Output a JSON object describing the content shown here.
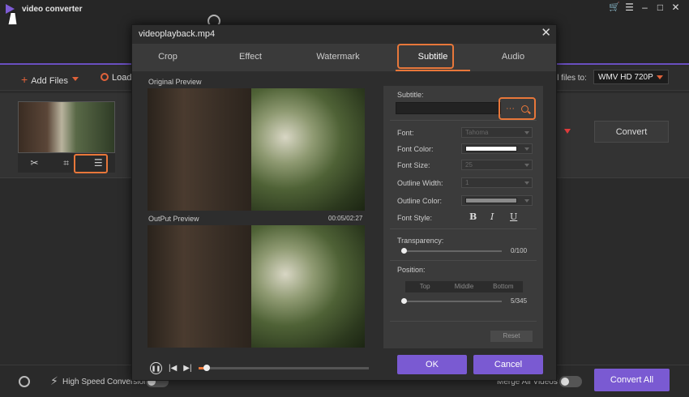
{
  "app": {
    "title": "video converter",
    "toolbar": {
      "add_files": "Add Files",
      "load": "Load"
    },
    "convert_all_label": "ll files to:",
    "format_value": "WMV HD 720P",
    "convert_button": "Convert",
    "footer": {
      "high_speed_label": "High Speed Conversion",
      "merge_label": "Merge All Videos",
      "convert_all_button": "Convert All"
    },
    "accent": "#7a5ad2",
    "highlight": "#e8773a"
  },
  "dialog": {
    "title": "videoplayback.mp4",
    "tabs": [
      "Crop",
      "Effect",
      "Watermark",
      "Subtitle",
      "Audio"
    ],
    "active_tab": "Subtitle",
    "original_preview_label": "Original Preview",
    "output_preview_label": "OutPut Preview",
    "timecode": "00:05/02:27",
    "subtitle": {
      "label": "Subtitle:",
      "more_glyph": "···",
      "font_label": "Font:",
      "font_value": "Tahoma",
      "font_color_label": "Font Color:",
      "font_color": "#ffffff",
      "font_size_label": "Font Size:",
      "font_size_value": "25",
      "outline_width_label": "Outline Width:",
      "outline_width_value": "1",
      "outline_color_label": "Outline Color:",
      "outline_color": "#8a8a8a",
      "font_style_label": "Font Style:",
      "bold": "B",
      "italic": "I",
      "underline": "U",
      "transparency_label": "Transparency:",
      "transparency_value": "0/100",
      "position_label": "Position:",
      "position_options": [
        "Top",
        "Middle",
        "Bottom"
      ],
      "position_value": "5/345",
      "reset": "Reset"
    },
    "ok": "OK",
    "cancel": "Cancel"
  }
}
